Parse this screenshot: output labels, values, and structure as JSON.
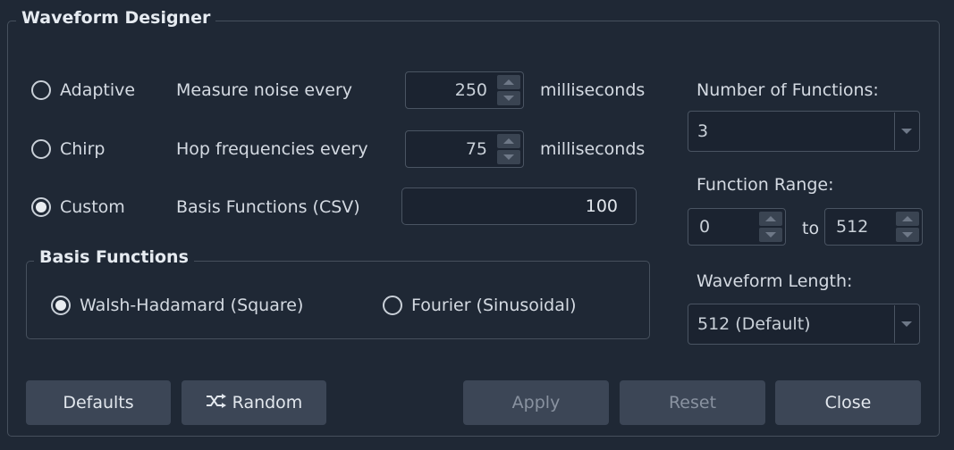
{
  "dialog": {
    "title": "Waveform Designer"
  },
  "modes": [
    {
      "label": "Adaptive",
      "checked": false,
      "setting_label": "Measure noise every",
      "value": "250",
      "unit": "milliseconds"
    },
    {
      "label": "Chirp",
      "checked": false,
      "setting_label": "Hop frequencies every",
      "value": "75",
      "unit": "milliseconds"
    },
    {
      "label": "Custom",
      "checked": true,
      "setting_label": "Basis Functions (CSV)",
      "value": "100"
    }
  ],
  "basis": {
    "title": "Basis Functions",
    "options": [
      {
        "label": "Walsh-Hadamard (Square)",
        "checked": true
      },
      {
        "label": "Fourier (Sinusoidal)",
        "checked": false
      }
    ]
  },
  "right_panel": {
    "num_functions_label": "Number of Functions:",
    "num_functions_value": "3",
    "range_label": "Function Range:",
    "range_from": "0",
    "range_to_label": "to",
    "range_to": "512",
    "length_label": "Waveform Length:",
    "length_value": "512 (Default)"
  },
  "buttons": {
    "defaults": "Defaults",
    "random": "Random",
    "apply": "Apply",
    "reset": "Reset",
    "close": "Close"
  },
  "icons": {
    "random": "shuffle-icon",
    "dropdown": "chevron-down-icon",
    "spin_up": "arrow-up-icon",
    "spin_down": "arrow-down-icon"
  }
}
